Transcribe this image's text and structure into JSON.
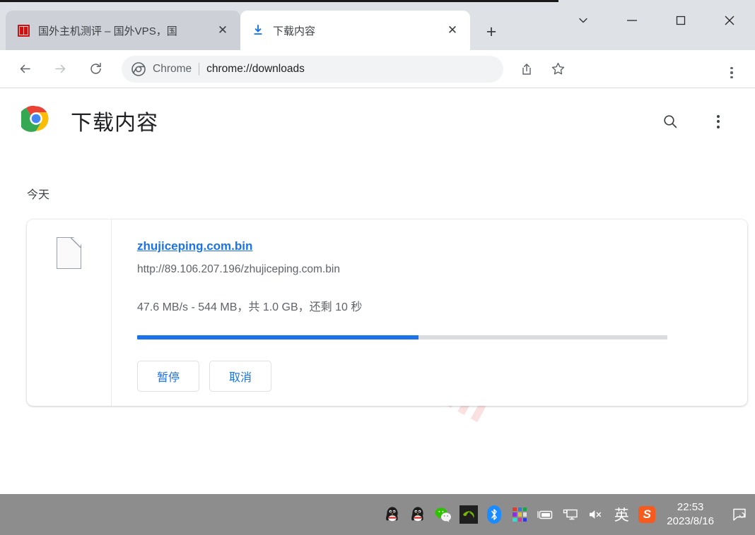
{
  "window": {
    "controls": [
      {
        "name": "tab-search",
        "glyph": "tab-search-chevron-icon"
      },
      {
        "name": "minimize",
        "glyph": "minimize-icon"
      },
      {
        "name": "maximize",
        "glyph": "maximize-icon"
      },
      {
        "name": "close",
        "glyph": "close-icon"
      }
    ]
  },
  "tabs": [
    {
      "title": "国外主机测评 – 国外VPS，国",
      "favicon": "red-seal-favicon",
      "active": false,
      "close_label": "✕"
    },
    {
      "title": "下载内容",
      "favicon": "download-arrow-icon",
      "active": true,
      "close_label": "✕"
    }
  ],
  "newtab_label": "+",
  "toolbar": {
    "back_icon": "arrow-left-icon",
    "forward_icon": "arrow-right-icon",
    "reload_icon": "reload-icon",
    "omnibox": {
      "icon": "chrome-logo-icon",
      "brand": "Chrome",
      "separator": "|",
      "url": "chrome://downloads"
    },
    "share_icon": "share-icon",
    "bookmark_icon": "star-icon",
    "menu_icon": "three-dot-menu-icon"
  },
  "page": {
    "logo": "chrome-logo",
    "title": "下载内容",
    "search_icon": "search-icon",
    "more_icon": "three-dot-menu-icon",
    "watermark": "zhujiceping.com",
    "section_label": "今天"
  },
  "download": {
    "file_icon": "generic-file-icon",
    "filename": "zhujiceping.com.bin",
    "url": "http://89.106.207.196/zhujiceping.com.bin",
    "status": "47.6 MB/s - 544 MB，共 1.0 GB，还剩 10 秒",
    "progress_percent": 53,
    "pause_label": "暂停",
    "cancel_label": "取消"
  },
  "taskbar": {
    "icons": [
      {
        "name": "qq-icon",
        "label": "QQ"
      },
      {
        "name": "qq-icon-2",
        "label": "QQ"
      },
      {
        "name": "wechat-icon",
        "label": "WeChat"
      },
      {
        "name": "nvidia-icon",
        "label": "NVIDIA"
      },
      {
        "name": "bluetooth-icon",
        "label": "Bluetooth"
      },
      {
        "name": "color-grid-icon",
        "label": "Colors"
      },
      {
        "name": "battery-icon",
        "label": "Battery"
      },
      {
        "name": "display-icon",
        "label": "Display"
      },
      {
        "name": "volume-muted-icon",
        "label": "Muted"
      }
    ],
    "ime": "英",
    "sogou": "S",
    "time": "22:53",
    "date": "2023/8/16",
    "notification_icon": "action-center-icon"
  },
  "colors": {
    "accent_blue": "#1a73e8",
    "tabstrip": "#dee1e6",
    "taskbar": "#8d8d8d",
    "watermark": "#fae0e0"
  }
}
